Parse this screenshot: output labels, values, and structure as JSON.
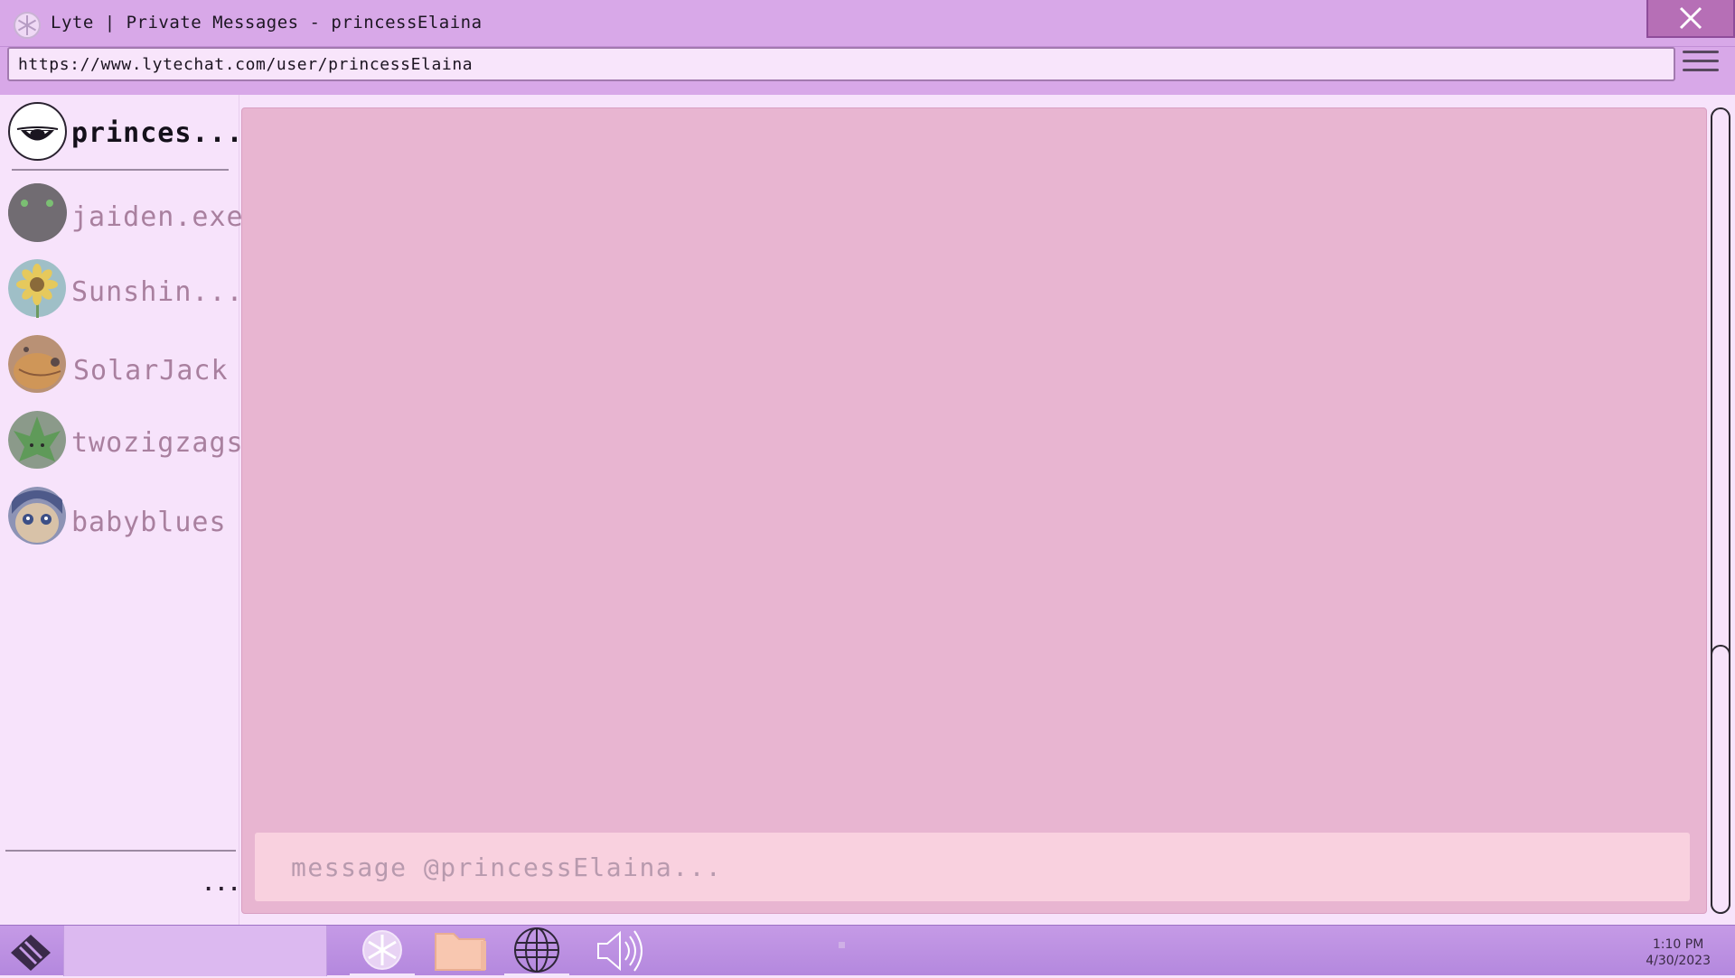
{
  "window": {
    "title": "Lyte | Private Messages - princessElaina",
    "app_icon": "lyte-asterisk-icon",
    "close_icon": "close-icon"
  },
  "address_bar": {
    "url": "https://www.lytechat.com/user/princessElaina",
    "menu_icon": "hamburger-menu-icon"
  },
  "sidebar": {
    "current_user": {
      "name": "princes...",
      "avatar": "eye-avatar"
    },
    "contacts": [
      {
        "name": "jaiden.exe",
        "avatar": "dark-blob-avatar"
      },
      {
        "name": "Sunshin...",
        "avatar": "sunflower-avatar"
      },
      {
        "name": "SolarJack",
        "avatar": "orange-creature-avatar"
      },
      {
        "name": "twozigzags",
        "avatar": "green-leaf-avatar"
      },
      {
        "name": "babyblues",
        "avatar": "blue-eyed-face-avatar"
      }
    ],
    "more_label": "..."
  },
  "chat": {
    "input_placeholder": "message @princessElaina..."
  },
  "taskbar": {
    "start_icon": "start-diamond-icon",
    "apps": [
      {
        "name": "lyte-app",
        "icon": "asterisk-icon",
        "active": true
      },
      {
        "name": "files-app",
        "icon": "folder-icon",
        "active": false
      },
      {
        "name": "browser-app",
        "icon": "globe-icon",
        "active": true
      },
      {
        "name": "volume",
        "icon": "speaker-icon",
        "active": false
      }
    ],
    "clock": {
      "time": "1:10 PM",
      "date": "4/30/2023"
    }
  },
  "colors": {
    "titlebar": "#d8a8e8",
    "chat_bg": "#e8b5d1",
    "input_bg": "#f9d1df",
    "taskbar": "#b488de"
  }
}
